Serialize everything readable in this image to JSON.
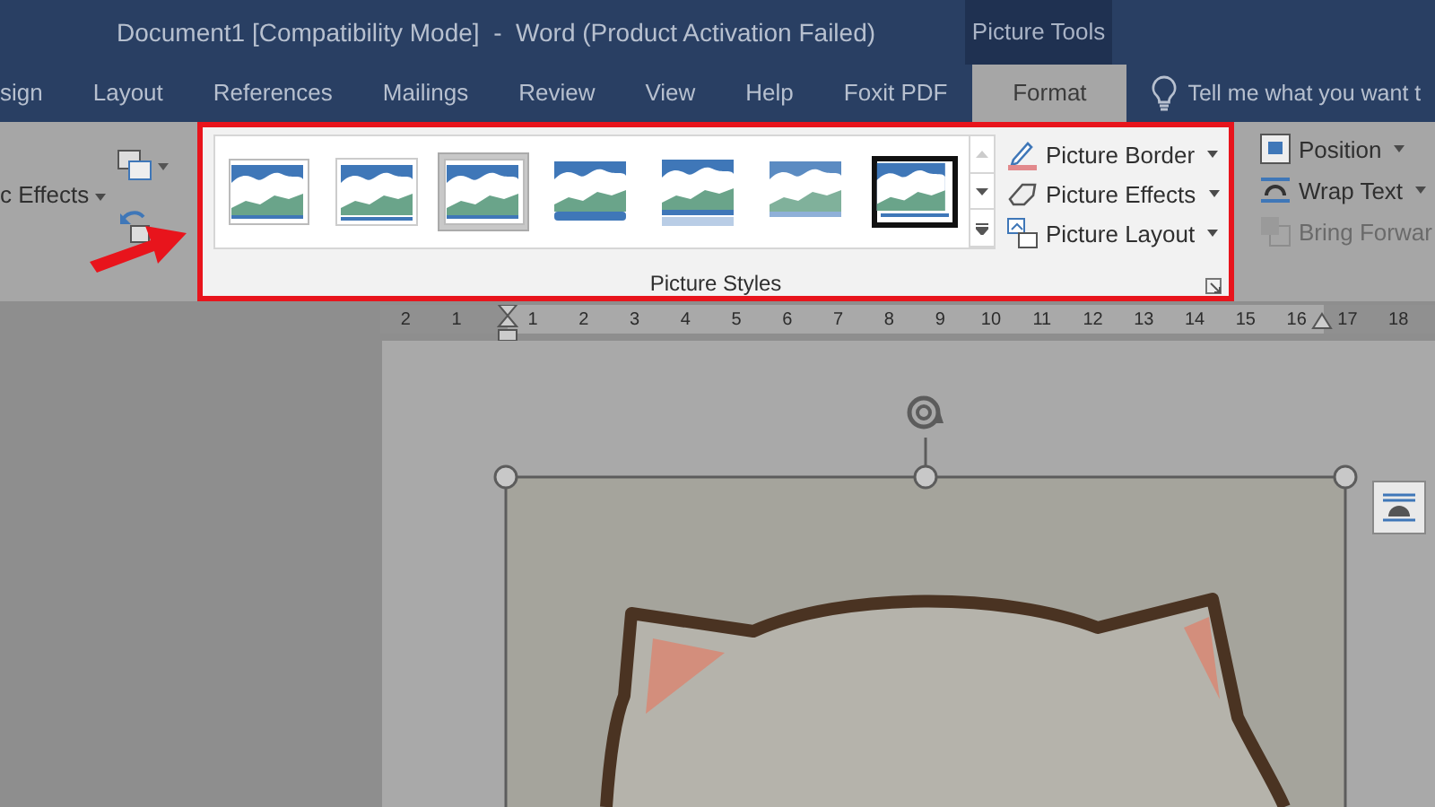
{
  "window": {
    "title": "Document1 [Compatibility Mode]  -  Word (Product Activation Failed)",
    "context_header": "Picture Tools"
  },
  "tabs": [
    {
      "label": "sign",
      "selected": false
    },
    {
      "label": "Layout",
      "selected": false
    },
    {
      "label": "References",
      "selected": false
    },
    {
      "label": "Mailings",
      "selected": false
    },
    {
      "label": "Review",
      "selected": false
    },
    {
      "label": "View",
      "selected": false
    },
    {
      "label": "Help",
      "selected": false
    },
    {
      "label": "Foxit PDF",
      "selected": false
    },
    {
      "label": "Format",
      "selected": true
    }
  ],
  "tell_me": {
    "placeholder": "Tell me what you want t"
  },
  "ribbon": {
    "left_command": {
      "label": "c Effects"
    },
    "picture_styles": {
      "title": "Picture Styles",
      "styles": [
        {
          "kind": "shadow",
          "selected": false
        },
        {
          "kind": "white-frame",
          "selected": false
        },
        {
          "kind": "shadow",
          "selected": true
        },
        {
          "kind": "rounded",
          "selected": false
        },
        {
          "kind": "reflected",
          "selected": false
        },
        {
          "kind": "soft",
          "selected": false
        },
        {
          "kind": "black-frame",
          "selected": false
        }
      ],
      "commands": [
        {
          "kind": "border",
          "label": "Picture Border"
        },
        {
          "kind": "effects",
          "label": "Picture Effects"
        },
        {
          "kind": "layout",
          "label": "Picture Layout"
        }
      ]
    },
    "arrange": [
      {
        "kind": "position",
        "label": "Position",
        "disabled": false
      },
      {
        "kind": "wrap",
        "label": "Wrap Text",
        "disabled": false
      },
      {
        "kind": "forward",
        "label": "Bring Forwar",
        "disabled": true
      }
    ]
  },
  "ruler": {
    "labels": [
      "2",
      "1",
      "1",
      "2",
      "3",
      "4",
      "5",
      "6",
      "7",
      "8",
      "9",
      "10",
      "11",
      "12",
      "13",
      "14",
      "15",
      "16",
      "17",
      "18"
    ]
  }
}
